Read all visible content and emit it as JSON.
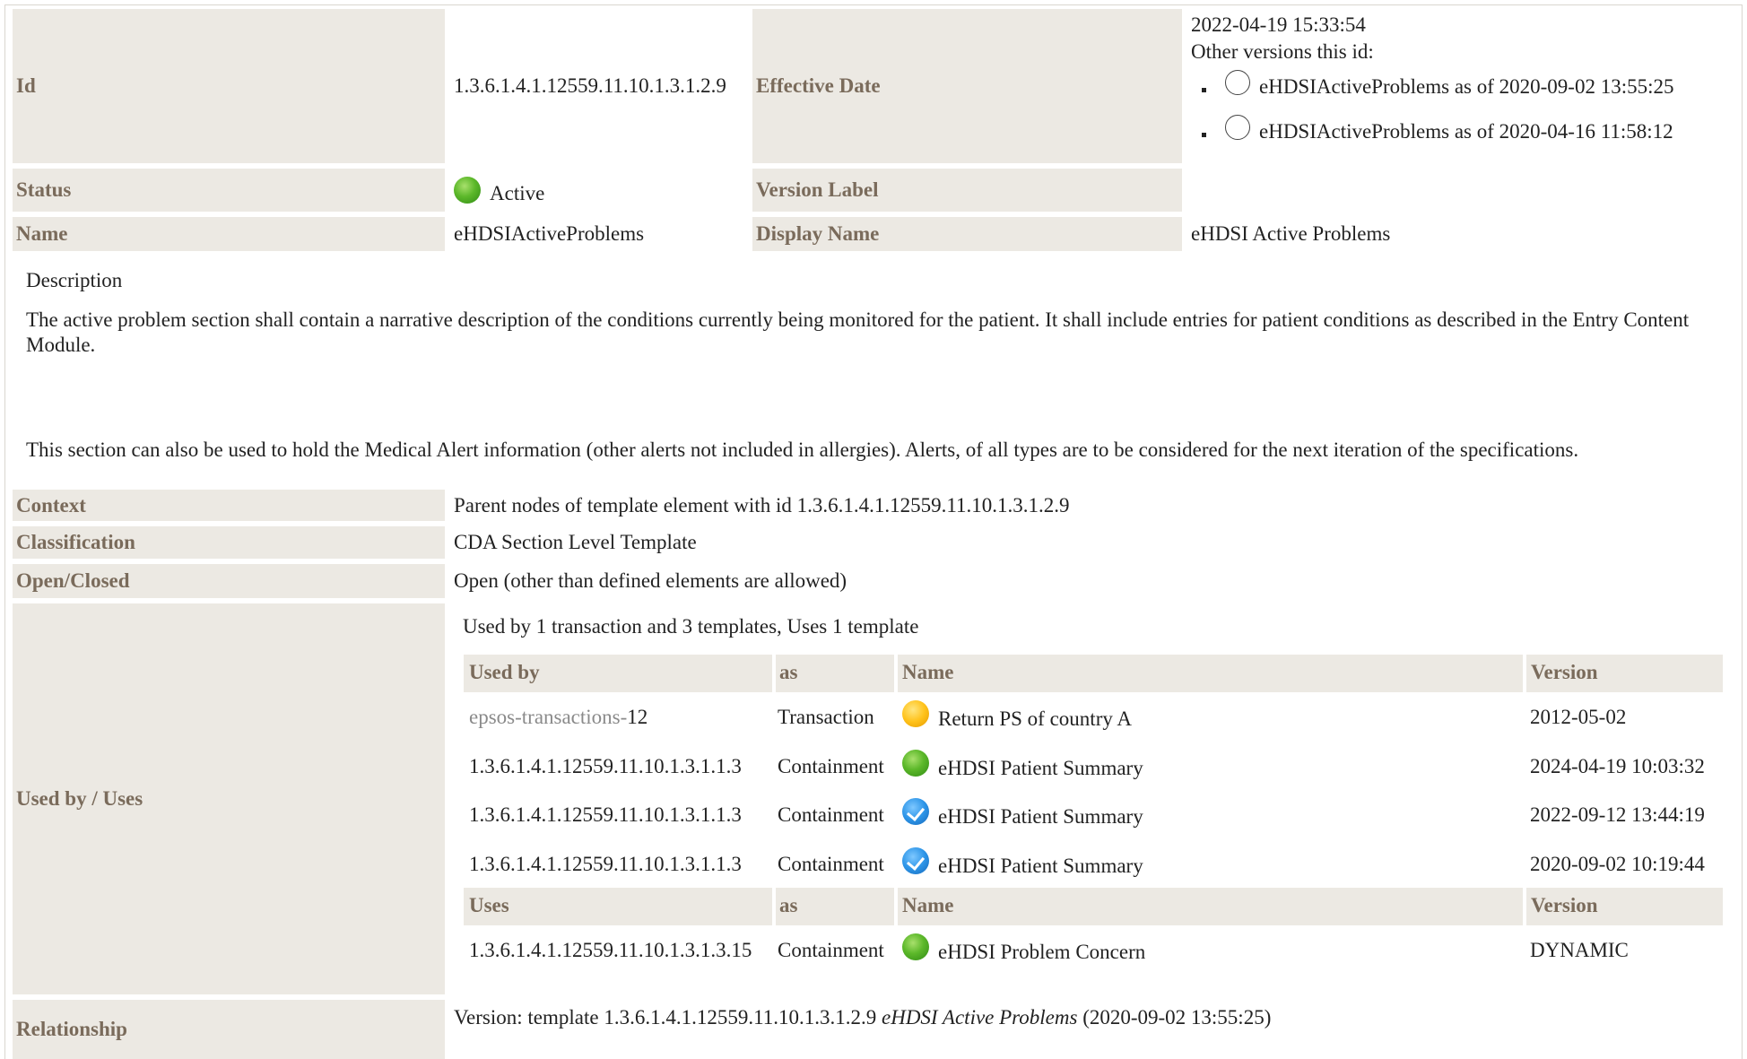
{
  "template": {
    "id": {
      "label": "Id",
      "value": "1.3.6.1.4.1.12559.11.10.1.3.1.2.9"
    },
    "effective_date": {
      "label": "Effective Date",
      "value": "2022-04-19 15:33:54",
      "other_versions_label": "Other versions this id:",
      "other_versions": [
        "eHDSIActiveProblems as of 2020-09-02 13:55:25",
        "eHDSIActiveProblems as of 2020-04-16 11:58:12"
      ]
    },
    "status": {
      "label": "Status",
      "value": "Active",
      "icon": "green-status-icon"
    },
    "version_label": {
      "label": "Version Label",
      "value": ""
    },
    "name": {
      "label": "Name",
      "value": "eHDSIActiveProblems"
    },
    "display_name": {
      "label": "Display Name",
      "value": "eHDSI Active Problems"
    },
    "description": {
      "heading": "Description",
      "paragraph1": "The active problem section shall contain a narrative description of the conditions currently being monitored for the patient. It shall include entries for patient conditions as described in the Entry Content Module.",
      "paragraph2": "This section can also be used to hold the Medical Alert information (other alerts not included in allergies). Alerts, of all types are to be considered for the next iteration of the specifications."
    },
    "context": {
      "label": "Context",
      "value": "Parent nodes of template element with id 1.3.6.1.4.1.12559.11.10.1.3.1.2.9"
    },
    "classification": {
      "label": "Classification",
      "value": "CDA Section Level Template"
    },
    "open_closed": {
      "label": "Open/Closed",
      "value": "Open (other than defined elements are allowed)"
    },
    "used_by_uses": {
      "label": "Used by / Uses",
      "summary": "Used by 1 transaction and 3 templates, Uses 1 template",
      "used_by_headers": [
        "Used by",
        "as",
        "Name",
        "Version"
      ],
      "used_by_rows": [
        {
          "ref_prefix": "epsos-transactions-",
          "ref": "12",
          "as": "Transaction",
          "status": "yellow",
          "name": "Return PS of country A",
          "version": "2012-05-02"
        },
        {
          "ref_prefix": "",
          "ref": "1.3.6.1.4.1.12559.11.10.1.3.1.1.3",
          "as": "Containment",
          "status": "green",
          "name": "eHDSI Patient Summary",
          "version": "2024-04-19 10:03:32"
        },
        {
          "ref_prefix": "",
          "ref": "1.3.6.1.4.1.12559.11.10.1.3.1.1.3",
          "as": "Containment",
          "status": "blue",
          "name": "eHDSI Patient Summary",
          "version": "2022-09-12 13:44:19"
        },
        {
          "ref_prefix": "",
          "ref": "1.3.6.1.4.1.12559.11.10.1.3.1.1.3",
          "as": "Containment",
          "status": "blue",
          "name": "eHDSI Patient Summary",
          "version": "2020-09-02 10:19:44"
        }
      ],
      "uses_headers": [
        "Uses",
        "as",
        "Name",
        "Version"
      ],
      "uses_rows": [
        {
          "ref": "1.3.6.1.4.1.12559.11.10.1.3.1.3.15",
          "as": "Containment",
          "status": "green",
          "name": "eHDSI Problem Concern",
          "version": "DYNAMIC"
        }
      ]
    },
    "relationship": {
      "label": "Relationship",
      "prefix": "Version: template 1.3.6.1.4.1.12559.11.10.1.3.1.2.9",
      "title": "eHDSI Active Problems",
      "date": "(2020-09-02 13:55:25)"
    },
    "colors": {
      "label_bg": "#ece9e3",
      "label_text": "#7a6b5b",
      "status_active": "#4caf28",
      "status_draft": "#ffc21a",
      "status_final": "#2d95e8"
    }
  }
}
